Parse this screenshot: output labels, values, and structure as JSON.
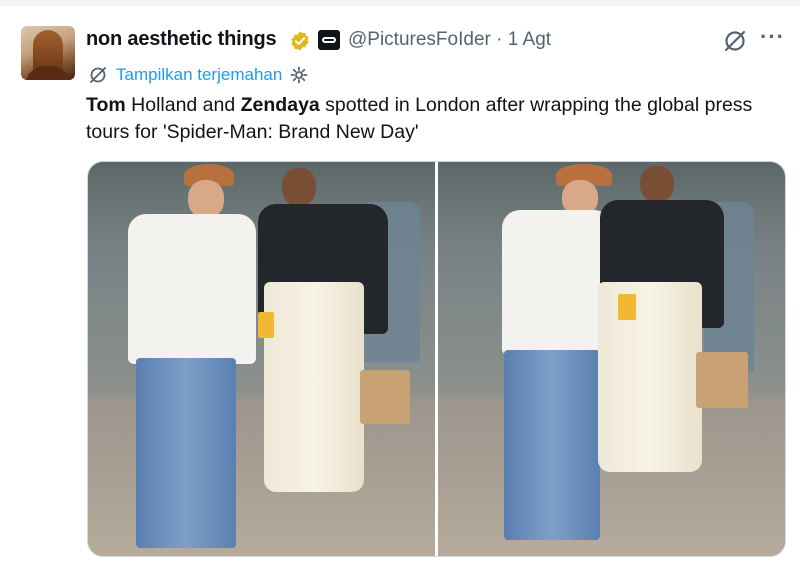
{
  "post": {
    "display_name": "non aesthetic things",
    "handle_time": "@PicturesFoIder · 1 Agt",
    "more_label": "···",
    "translate_label": "Tampilkan terjemahan",
    "text_parts": {
      "name1": "Tom",
      "seg1": " Holland and ",
      "name2": "Zendaya",
      "seg2": " spotted in London after wrapping the global press tours for 'Spider-Man: Brand New Day'"
    }
  },
  "icons": {
    "verified": "verified-badge-icon",
    "affiliate": "affiliate-badge-icon",
    "grok": "grok-icon",
    "translate": "translate-icon",
    "settings": "gear-icon"
  },
  "colors": {
    "accent": "#1d9bf0",
    "verified_gold": "#e2b719",
    "secondary_text": "#536471"
  },
  "media": {
    "count": 2
  }
}
